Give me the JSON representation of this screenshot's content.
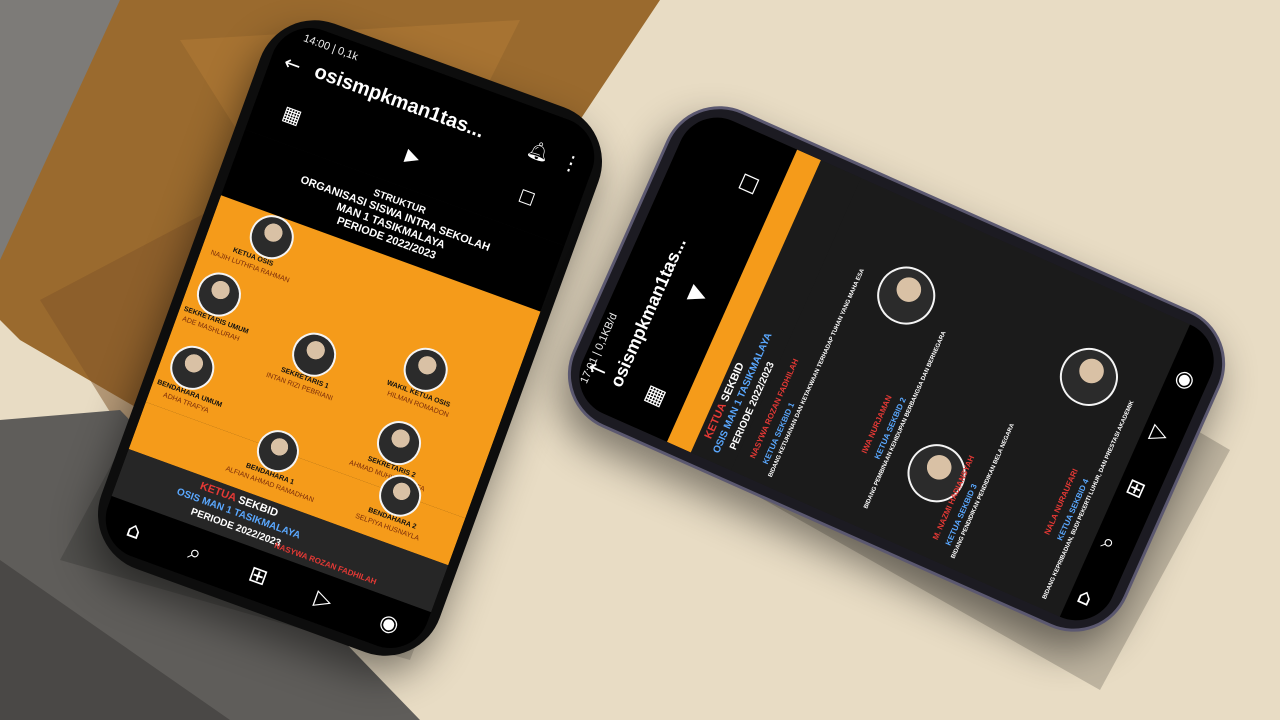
{
  "phone_left": {
    "status_time": "14:00 | 0,1k",
    "username": "osismpkman1tas...",
    "post": {
      "heading": [
        "STRUKTUR",
        "ORGANISASI SISWA INTRA SEKOLAH",
        "MAN 1 TASIKMALAYA",
        "PERIODE 2022/2023"
      ],
      "members": [
        {
          "role": "KETUA OSIS",
          "name": "NAJIH LUTHFIA RAHMAN"
        },
        {
          "role": "SEKRETARIS UMUM",
          "name": "ADE MASHLURAH"
        },
        {
          "role": "WAKIL KETUA OSIS",
          "name": "HILMAN ROMADON"
        },
        {
          "role": "SEKRETARIS 1",
          "name": "INTAN RIZI PEBRIANI"
        },
        {
          "role": "BENDAHARA UMUM",
          "name": "ADHA TRAFYA"
        },
        {
          "role": "SEKRETARIS 2",
          "name": "AHMAD MUHIBUL MUFA"
        },
        {
          "role": "BENDAHARA 1",
          "name": "ALFIAN AHMAD RAMADHAN"
        },
        {
          "role": "BENDAHARA 2",
          "name": "SELPIYA HUSNAYLA"
        }
      ],
      "sekbid": [
        "KETUA",
        "SEKBID",
        "OSIS MAN 1 TASIKMALAYA",
        "PERIODE 2022/2023"
      ],
      "bottom_name": "NASYWA ROZAN FADHILAH"
    },
    "nav_icons": [
      "home-icon",
      "search-icon",
      "add-icon",
      "reels-icon",
      "profile-icon"
    ]
  },
  "phone_right": {
    "status_time": "17:01 | 0,1KB/d",
    "username": "osismpkman1tas...",
    "header": [
      "KETUA",
      "SEKBID",
      "OSIS MAN 1 TASIKMALAYA",
      "PERIODE 2022/2023"
    ],
    "entries": [
      {
        "name": "NASYWA ROZAN FADHILAH",
        "title": "KETUA SEKBID 1",
        "desc": "BIDANG KETUHANAN DAN KETAKWAAN TERHADAP TUHAN YANG MAHA ESA"
      },
      {
        "name": "IWA NURJAMAN",
        "title": "KETUA SEKBID 2",
        "desc": "BIDANG PEMBINAAN KEHIDUPAN BERBANGSA DAN BERNEGARA"
      },
      {
        "name": "M. NAZMI HADIANSYAH",
        "title": "KETUA SEKBID 3",
        "desc": "BIDANG PENDIDIKAN PENDIDIKAN BELA NEGARA"
      },
      {
        "name": "NALA NURAUFARI",
        "title": "KETUA SEKBID 4",
        "desc": "BIDANG KEPRIBADIAN, BUDI PEKERTI LUHUR, DAN PRESTASI AKADEMIK"
      },
      {
        "name": "TRIANA ADILA FAUZIAH",
        "title": "",
        "desc": ""
      }
    ]
  },
  "colors": {
    "accent_orange": "#f59b1a",
    "screen_dark": "#1b1b1b",
    "red_label": "#e53935",
    "blue_label": "#5aa8ff"
  }
}
